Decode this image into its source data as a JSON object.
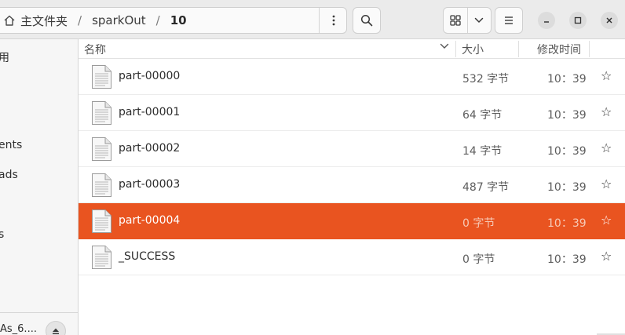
{
  "breadcrumb": {
    "home_label": "主文件夹",
    "separator": "/",
    "items": [
      "sparkOut",
      "10"
    ]
  },
  "sidebar": {
    "items": [
      "用",
      "ents",
      "ads",
      "s"
    ],
    "bottom_label": "As_6...."
  },
  "columns": {
    "name": "名称",
    "size": "大小",
    "modified": "修改时间"
  },
  "files": [
    {
      "name": "part-00000",
      "size": "532 字节",
      "time": "10：39",
      "star": "☆"
    },
    {
      "name": "part-00001",
      "size": "64 字节",
      "time": "10：39",
      "star": "☆"
    },
    {
      "name": "part-00002",
      "size": "14 字节",
      "time": "10：39",
      "star": "☆"
    },
    {
      "name": "part-00003",
      "size": "487 字节",
      "time": "10：39",
      "star": "☆"
    },
    {
      "name": "part-00004",
      "size": "0 字节",
      "time": "10：39",
      "star": "☆",
      "selected": true
    },
    {
      "name": "_SUCCESS",
      "size": "0 字节",
      "time": "10：39",
      "star": "☆"
    }
  ],
  "colors": {
    "accent": "#e95420",
    "headerbar": "#ebebeb",
    "sidebar": "#f6f6f6"
  },
  "icons": {
    "home": "home-icon",
    "path_menu": "kebab-menu-icon",
    "search": "search-icon",
    "view": "grid-view-icon",
    "view_options": "chevron-down-icon",
    "main_menu": "hamburger-menu-icon",
    "minimize": "minimize-icon",
    "maximize": "maximize-icon",
    "close": "close-icon",
    "file": "text-file-icon",
    "star": "star-icon",
    "eject": "eject-icon",
    "sort": "chevron-down-icon"
  }
}
